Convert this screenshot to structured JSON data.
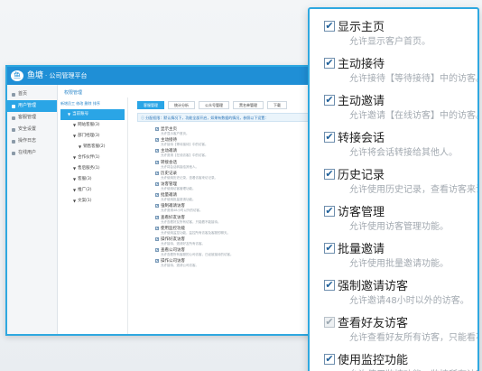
{
  "app": {
    "logo_text": "鱼",
    "brand": "鱼塘",
    "title": "· 公司管理平台"
  },
  "sidebar": {
    "items": [
      {
        "label": "首页",
        "active": false
      },
      {
        "label": "用户管理",
        "active": true
      },
      {
        "label": "客服管理",
        "active": false
      },
      {
        "label": "安全设置",
        "active": false
      },
      {
        "label": "操作日志",
        "active": false
      },
      {
        "label": "在线用户",
        "active": false
      }
    ]
  },
  "breadcrumb": "权限管理",
  "tree": {
    "tabs": "新增员工  修改  删除  排序",
    "nodes": [
      {
        "label": "当前账号",
        "level": 0,
        "active": true
      },
      {
        "label": "网站客服(3)",
        "level": 1
      },
      {
        "label": "部门经理(3)",
        "level": 1
      },
      {
        "label": "销售客服(2)",
        "level": 2
      },
      {
        "label": "合作伙伴(1)",
        "level": 1
      },
      {
        "label": "售后服务(1)",
        "level": 1
      },
      {
        "label": "客服(3)",
        "level": 1
      },
      {
        "label": "推广(2)",
        "level": 1
      },
      {
        "label": "文案(1)",
        "level": 1
      }
    ]
  },
  "tabs": [
    "客服管理",
    "统计分析",
    "公众号管理",
    "黑名单管理",
    "下载"
  ],
  "notice": "分配权限：默认情况下，功能全部开启，如果有数据的情况，参照以下设置：",
  "small_permissions": [
    {
      "title": "显示主页",
      "desc": "允许显示客户首页。"
    },
    {
      "title": "主动接待",
      "desc": "允许接待【等待接待】中的访客。"
    },
    {
      "title": "主动邀请",
      "desc": "允许邀请【在线访客】中的访客。"
    },
    {
      "title": "转接会话",
      "desc": "允许将会话转接给其他人。"
    },
    {
      "title": "历史记录",
      "desc": "允许使用历史记录，查看访客来访记录。"
    },
    {
      "title": "访客管理",
      "desc": "允许使用访客管理功能。"
    },
    {
      "title": "批量邀请",
      "desc": "允许使用批量邀请功能。"
    },
    {
      "title": "强制邀请访客",
      "desc": "允许邀请48小时以外的访客。"
    },
    {
      "title": "查看好友访客",
      "desc": "允许查看好友所有访客，只能看不能接待。"
    },
    {
      "title": "使用监控功能",
      "desc": "允许使用监控功能，监控所有访客及客服的聊天。"
    },
    {
      "title": "操作好友访客",
      "desc": "允许接待、邀请好友所有访客。"
    },
    {
      "title": "查看公司访客",
      "desc": "允许查看所有客服的公司访客，已经被接待的访客。"
    },
    {
      "title": "操作公司访客",
      "desc": "允许接待、邀请公司访客。"
    }
  ],
  "zoom_permissions": [
    {
      "title": "显示主页",
      "desc": "允许显示客户首页。",
      "checked": true
    },
    {
      "title": "主动接待",
      "desc": "允许接待【等待接待】中的访客。",
      "checked": true
    },
    {
      "title": "主动邀请",
      "desc": "允许邀请【在线访客】中的访客。",
      "checked": true
    },
    {
      "title": "转接会话",
      "desc": "允许将会话转接给其他人。",
      "checked": true
    },
    {
      "title": "历史记录",
      "desc": "允许使用历史记录，查看访客来访记录",
      "checked": true
    },
    {
      "title": "访客管理",
      "desc": "允许使用访客管理功能。",
      "checked": true
    },
    {
      "title": "批量邀请",
      "desc": "允许使用批量邀请功能。",
      "checked": true
    },
    {
      "title": "强制邀请访客",
      "desc": "允许邀请48小时以外的访客。",
      "checked": true
    },
    {
      "title": "查看好友访客",
      "desc": "允许查看好友所有访客，只能看不能接",
      "checked": true,
      "disabled": true
    },
    {
      "title": "使用监控功能",
      "desc": "允许使用监控功能，监控所有访客及",
      "checked": true
    }
  ],
  "check_glyph": "✔",
  "colors": {
    "accent": "#2fa8e0",
    "header": "#1f8fd6",
    "active": "#2aa5e6"
  }
}
